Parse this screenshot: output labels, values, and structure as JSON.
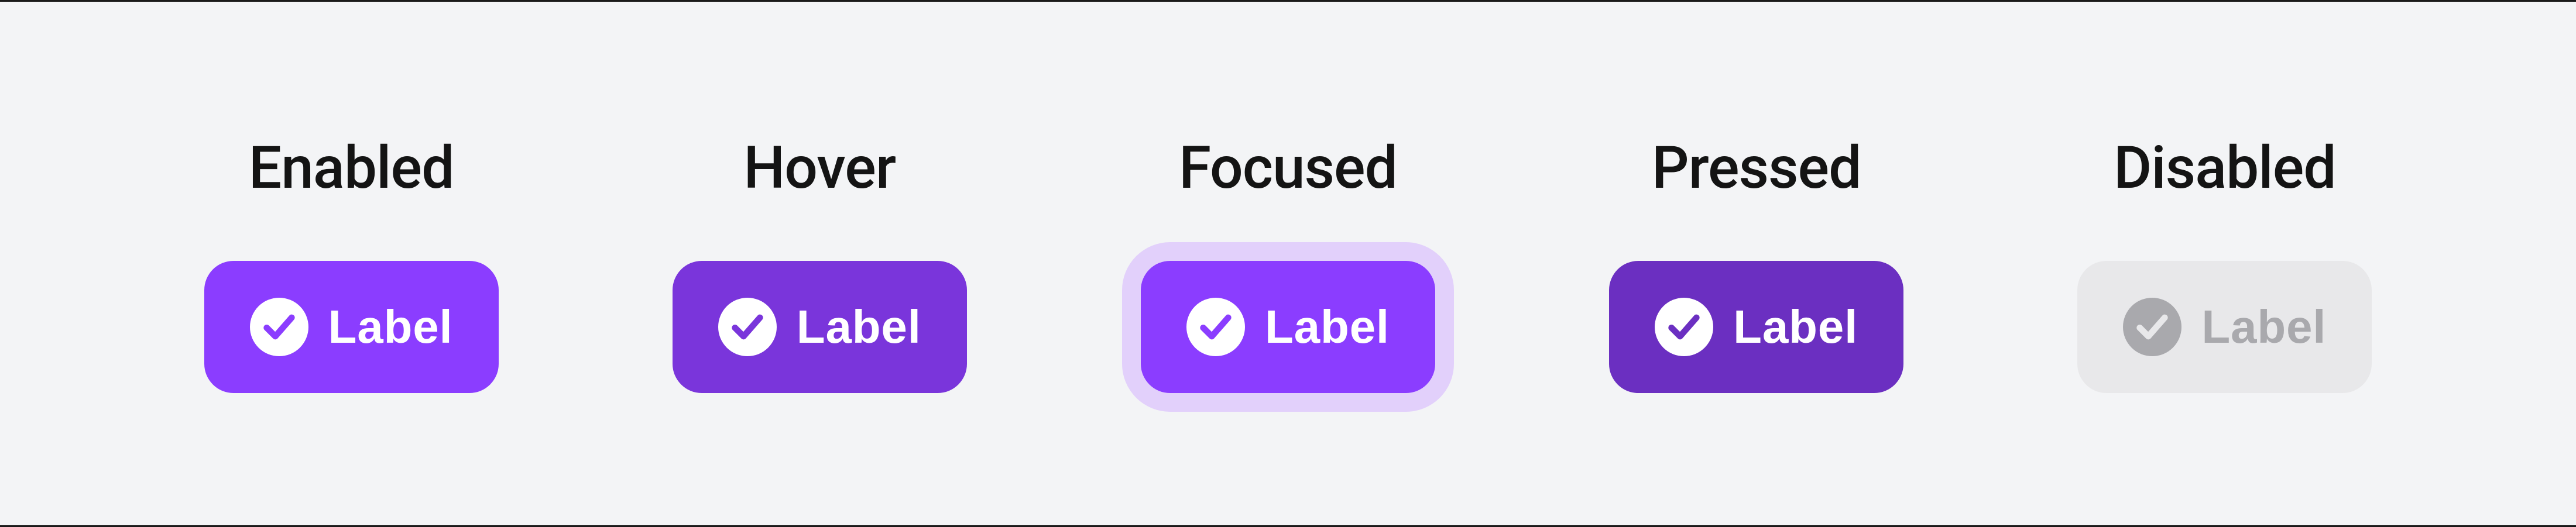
{
  "states": [
    {
      "title": "Enabled",
      "label": "Label",
      "variant": "enabled",
      "interactable": true
    },
    {
      "title": "Hover",
      "label": "Label",
      "variant": "hover",
      "interactable": true
    },
    {
      "title": "Focused",
      "label": "Label",
      "variant": "focused",
      "interactable": true
    },
    {
      "title": "Pressed",
      "label": "Label",
      "variant": "pressed",
      "interactable": true
    },
    {
      "title": "Disabled",
      "label": "Label",
      "variant": "disabled",
      "interactable": false
    }
  ],
  "colors": {
    "enabled": "#8b3dff",
    "hover": "#7a35db",
    "focused": "#8b3dff",
    "pressed": "#6b2fc1",
    "disabled_bg": "#e8e8ea",
    "disabled_fg": "#a9a9ad",
    "focus_ring": "#e2d0fb",
    "page_bg": "#f3f4f6",
    "title": "#141414"
  }
}
